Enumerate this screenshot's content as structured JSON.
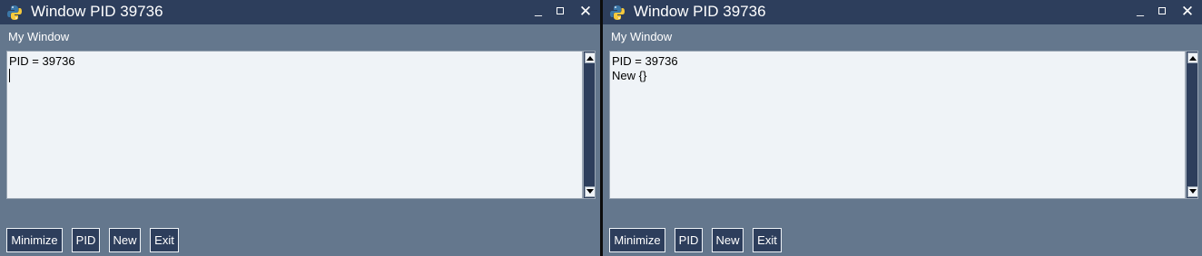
{
  "windows": [
    {
      "title": "Window PID 39736",
      "label": "My Window",
      "output_lines": "PID = 39736",
      "buttons": [
        "Minimize",
        "PID",
        "New",
        "Exit"
      ]
    },
    {
      "title": "Window PID 39736",
      "label": "My Window",
      "output_lines": "PID = 39736\nNew {}",
      "buttons": [
        "Minimize",
        "PID",
        "New",
        "Exit"
      ]
    }
  ],
  "titlebar_controls": {
    "minimize": "_",
    "close": "✕"
  },
  "icons": {
    "app": "python-icon",
    "minimize": "minimize-icon",
    "maximize": "maximize-icon",
    "close": "close-icon"
  },
  "colors": {
    "titlebar": "#2d3e5c",
    "window_bg": "#64778d",
    "output_bg": "#eff3f7",
    "button_bg": "#2d3e5c",
    "text_light": "#ffffff"
  }
}
